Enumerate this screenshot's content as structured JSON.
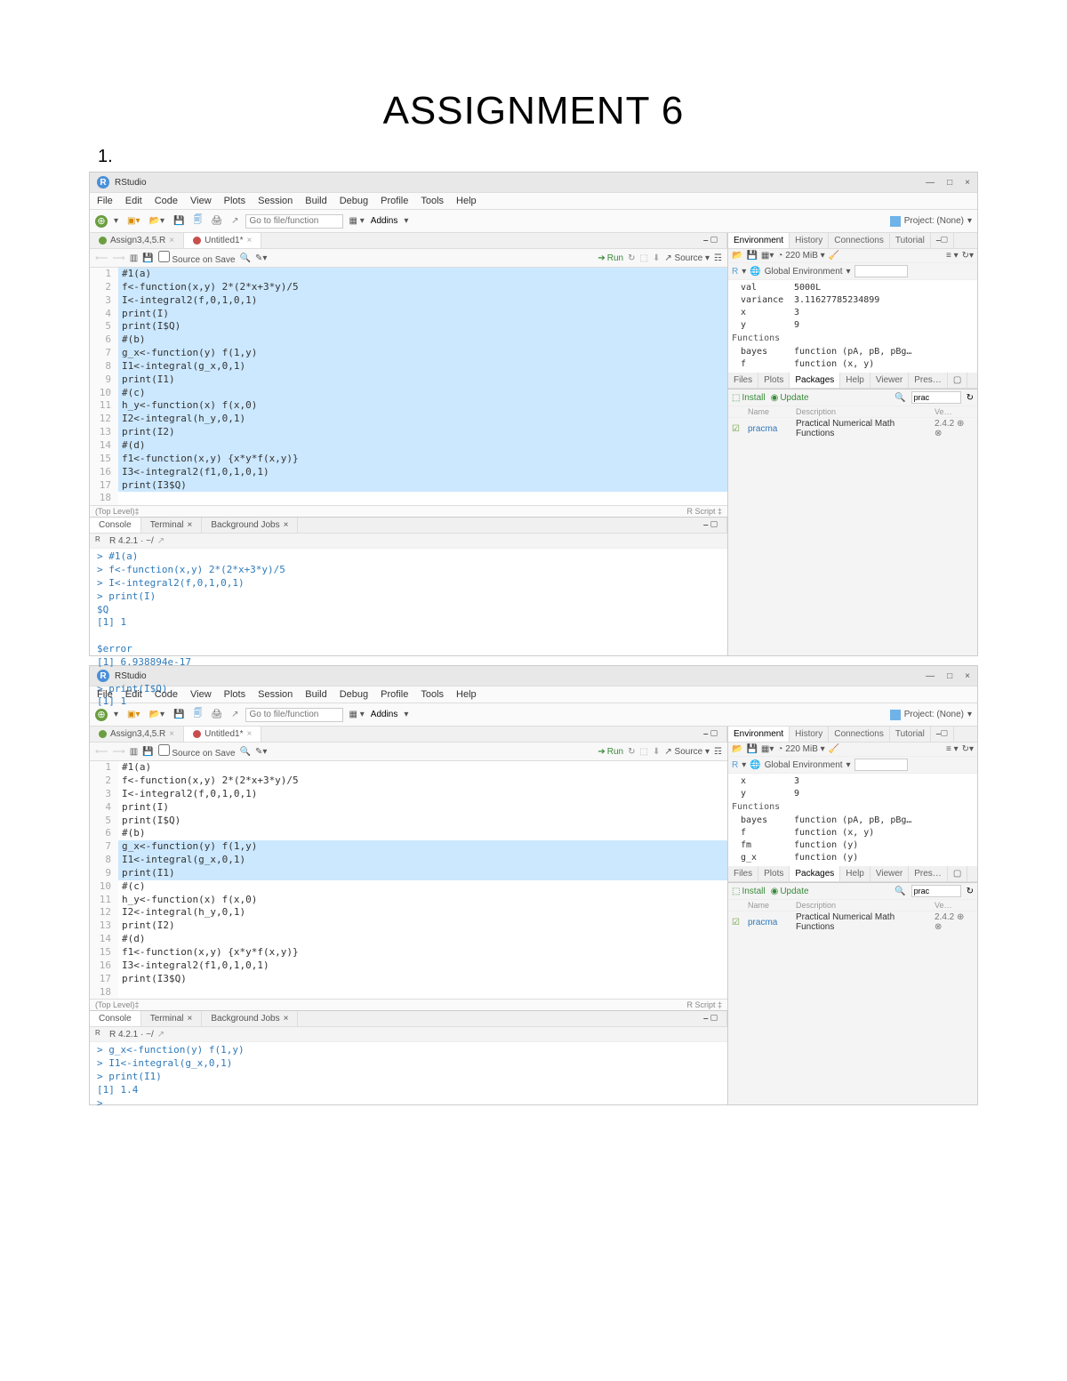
{
  "doc": {
    "title": "ASSIGNMENT 6",
    "qnum": "1."
  },
  "app": {
    "name": "RStudio",
    "minimize": "—",
    "maximize": "□",
    "close": "×"
  },
  "menu": [
    "File",
    "Edit",
    "Code",
    "View",
    "Plots",
    "Session",
    "Build",
    "Debug",
    "Profile",
    "Tools",
    "Help"
  ],
  "toolbar": {
    "goto": "Go to file/function",
    "addins": "Addins",
    "project": "Project: (None)"
  },
  "s1": {
    "tabs": {
      "a": "Assign3,4,5.R",
      "b": "Untitled1*"
    },
    "mini": {
      "source_save": "Source on Save",
      "run": "Run",
      "source": "Source"
    },
    "footer": {
      "l": "(Top Level)",
      "r": "R Script"
    },
    "code": [
      {
        "n": "1",
        "hl": true,
        "txt": "#1(a)"
      },
      {
        "n": "2",
        "hl": true,
        "txt": "f<-function(x,y) 2*(2*x+3*y)/5"
      },
      {
        "n": "3",
        "hl": true,
        "txt": "I<-integral2(f,0,1,0,1)"
      },
      {
        "n": "4",
        "hl": true,
        "txt": "print(I)"
      },
      {
        "n": "5",
        "hl": true,
        "txt": "print(I$Q)"
      },
      {
        "n": "6",
        "hl": true,
        "txt": "#(b)"
      },
      {
        "n": "7",
        "hl": true,
        "txt": "g_x<-function(y) f(1,y)"
      },
      {
        "n": "8",
        "hl": true,
        "txt": "I1<-integral(g_x,0,1)"
      },
      {
        "n": "9",
        "hl": true,
        "txt": "print(I1)"
      },
      {
        "n": "10",
        "hl": true,
        "txt": "#(c)"
      },
      {
        "n": "11",
        "hl": true,
        "txt": "h_y<-function(x) f(x,0)"
      },
      {
        "n": "12",
        "hl": true,
        "txt": "I2<-integral(h_y,0,1)"
      },
      {
        "n": "13",
        "hl": true,
        "txt": "print(I2)"
      },
      {
        "n": "14",
        "hl": true,
        "txt": "#(d)"
      },
      {
        "n": "15",
        "hl": true,
        "txt": "f1<-function(x,y) {x*y*f(x,y)}"
      },
      {
        "n": "16",
        "hl": true,
        "txt": "I3<-integral2(f1,0,1,0,1)"
      },
      {
        "n": "17",
        "hl": true,
        "txt": "print(I3$Q)"
      },
      {
        "n": "18",
        "hl": false,
        "txt": ""
      }
    ],
    "console_head": "R 4.2.1 · ~/",
    "console": "> #1(a)\n> f<-function(x,y) 2*(2*x+3*y)/5\n> I<-integral2(f,0,1,0,1)\n> print(I)\n$Q\n[1] 1\n\n$error\n[1] 6.938894e-17\n\n> print(I$Q)\n[1] 1",
    "env": {
      "scope": "Global Environment",
      "vars": [
        {
          "k": "val",
          "v": "5000L"
        },
        {
          "k": "variance",
          "v": "3.11627785234899"
        },
        {
          "k": "x",
          "v": "3"
        },
        {
          "k": "y",
          "v": "9"
        }
      ],
      "funcs_label": "Functions",
      "funcs": [
        {
          "k": "bayes",
          "v": "function (pA, pB, pBg…"
        },
        {
          "k": "f",
          "v": "function (x, y)"
        }
      ]
    }
  },
  "s2": {
    "tabs": {
      "a": "Assign3,4,5.R",
      "b": "Untitled1*"
    },
    "code": [
      {
        "n": "1",
        "hl": false,
        "txt": "#1(a)"
      },
      {
        "n": "2",
        "hl": false,
        "txt": "f<-function(x,y) 2*(2*x+3*y)/5"
      },
      {
        "n": "3",
        "hl": false,
        "txt": "I<-integral2(f,0,1,0,1)"
      },
      {
        "n": "4",
        "hl": false,
        "txt": "print(I)"
      },
      {
        "n": "5",
        "hl": false,
        "txt": "print(I$Q)"
      },
      {
        "n": "6",
        "hl": false,
        "txt": "#(b)"
      },
      {
        "n": "7",
        "hl": true,
        "txt": "g_x<-function(y) f(1,y)"
      },
      {
        "n": "8",
        "hl": true,
        "txt": "I1<-integral(g_x,0,1)"
      },
      {
        "n": "9",
        "hl": true,
        "txt": "print(I1)"
      },
      {
        "n": "10",
        "hl": false,
        "txt": "#(c)"
      },
      {
        "n": "11",
        "hl": false,
        "txt": "h_y<-function(x) f(x,0)"
      },
      {
        "n": "12",
        "hl": false,
        "txt": "I2<-integral(h_y,0,1)"
      },
      {
        "n": "13",
        "hl": false,
        "txt": "print(I2)"
      },
      {
        "n": "14",
        "hl": false,
        "txt": "#(d)"
      },
      {
        "n": "15",
        "hl": false,
        "txt": "f1<-function(x,y) {x*y*f(x,y)}"
      },
      {
        "n": "16",
        "hl": false,
        "txt": "I3<-integral2(f1,0,1,0,1)"
      },
      {
        "n": "17",
        "hl": false,
        "txt": "print(I3$Q)"
      },
      {
        "n": "18",
        "hl": false,
        "txt": ""
      }
    ],
    "console": "> g_x<-function(y) f(1,y)\n> I1<-integral(g_x,0,1)\n> print(I1)\n[1] 1.4\n> ",
    "env": {
      "vars": [
        {
          "k": "x",
          "v": "3"
        },
        {
          "k": "y",
          "v": "9"
        }
      ],
      "funcs": [
        {
          "k": "bayes",
          "v": "function (pA, pB, pBg…"
        },
        {
          "k": "f",
          "v": "function (x, y)"
        },
        {
          "k": "fm",
          "v": "function (y)"
        },
        {
          "k": "g_x",
          "v": "function (y)"
        }
      ]
    }
  },
  "rtabs": {
    "env": "Environment",
    "hist": "History",
    "conn": "Connections",
    "tut": "Tutorial",
    "files": "Files",
    "plots": "Plots",
    "packages": "Packages",
    "help": "Help",
    "viewer": "Viewer",
    "pres": "Pres…"
  },
  "mem": "220 MiB",
  "pkg": {
    "install": "Install",
    "update": "Update",
    "search": "prac",
    "h_name": "Name",
    "h_desc": "Description",
    "h_ver": "Ve…",
    "row": {
      "name": "pracma",
      "desc": "Practical Numerical Math Functions",
      "ver": "2.4.2"
    }
  },
  "ctabs": {
    "console": "Console",
    "terminal": "Terminal",
    "bgjobs": "Background Jobs"
  }
}
